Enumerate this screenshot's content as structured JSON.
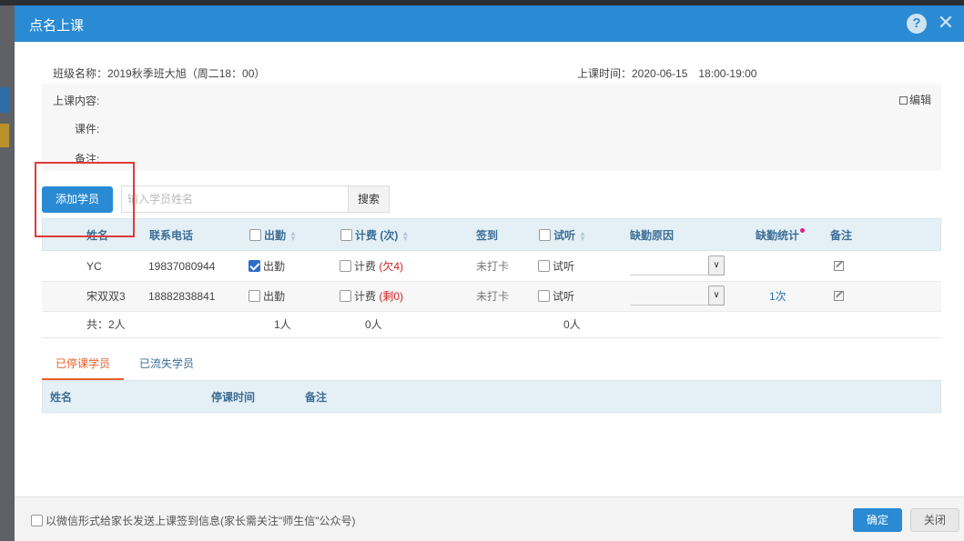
{
  "dialog": {
    "title": "点名上课",
    "help_glyph": "?",
    "close_glyph": "✕"
  },
  "info": {
    "class_name": "班级名称：2019秋季班大旭（周二18：00）",
    "class_time": "上课时间：2020-06-15　18:00-19:00",
    "content_label": "上课内容:",
    "courseware_label": "课件:",
    "remark_label": "备注:",
    "edit_label": "编辑"
  },
  "toolbar": {
    "add_student_label": "添加学员",
    "search_placeholder": "输入学员姓名",
    "search_label": "搜索"
  },
  "table": {
    "headers": {
      "name": "姓名",
      "phone": "联系电话",
      "attendance": "出勤",
      "charge": "计费 (次)",
      "sign": "签到",
      "trial": "试听",
      "absence_reason": "缺勤原因",
      "absence_stats": "缺勤统计",
      "remark": "备注"
    },
    "rows": [
      {
        "name": "YC",
        "phone": "19837080944",
        "attendance_label": "出勤",
        "attendance_checked": true,
        "charge_label": "计费",
        "charge_note": "(欠4)",
        "sign": "未打卡",
        "trial_label": "试听",
        "absence_stats": ""
      },
      {
        "name": "宋双双3",
        "phone": "18882838841",
        "attendance_label": "出勤",
        "attendance_checked": false,
        "charge_label": "计费",
        "charge_note": "(剩0)",
        "sign": "未打卡",
        "trial_label": "试听",
        "absence_stats": "1次"
      }
    ],
    "totals": {
      "count": "共：2人",
      "attendance": "1人",
      "charge": "0人",
      "trial": "0人"
    }
  },
  "tabs": [
    {
      "label": "已停课学员",
      "active": true
    },
    {
      "label": "已流失学员",
      "active": false
    }
  ],
  "stopped_table": {
    "headers": {
      "name": "姓名",
      "stop_time": "停课时间",
      "remark": "备注"
    }
  },
  "footer": {
    "wechat_notice": "以微信形式给家长发送上课签到信息(家长需关注\"师生信\"公众号)",
    "confirm_label": "确定",
    "close_label": "关闭"
  },
  "colors": {
    "primary": "#2a8ad3",
    "active_tab": "#e8602a",
    "debt_red": "#d32020",
    "highlight_box": "#e03a3a"
  }
}
